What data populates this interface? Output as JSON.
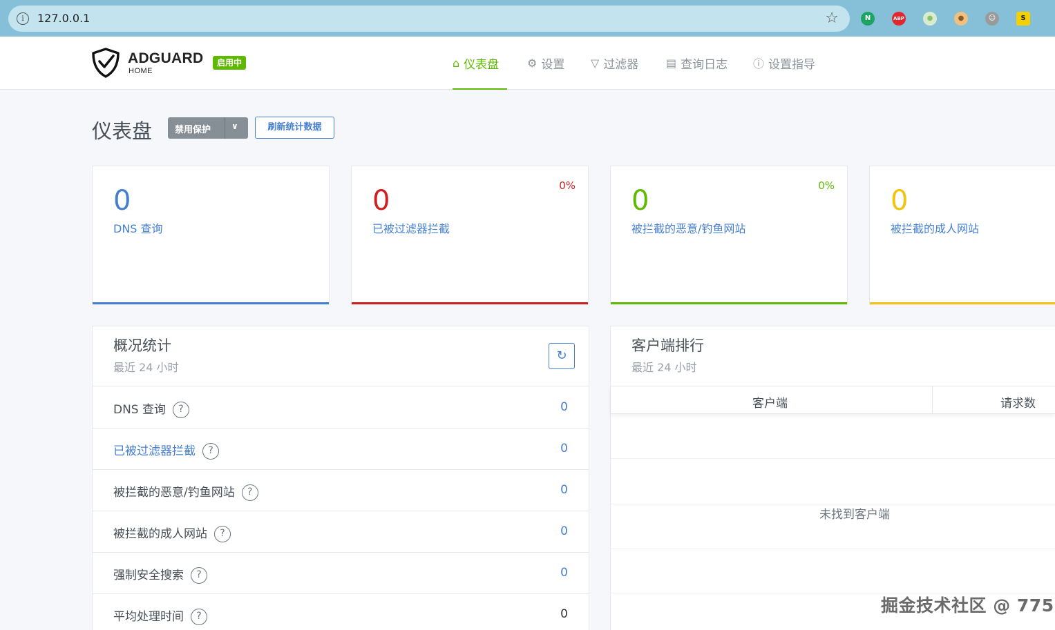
{
  "browser": {
    "url": "127.0.0.1",
    "extensions": [
      {
        "name": "n-icon",
        "glyph": "N",
        "color": "#1da462"
      },
      {
        "name": "adblock-plus-icon",
        "glyph": "ABP",
        "color": "#e3262d"
      },
      {
        "name": "circle-extension-icon",
        "glyph": "●",
        "color": "#8ebf6a"
      },
      {
        "name": "cookie-icon",
        "glyph": "🍪",
        "color": "#c68a3a"
      },
      {
        "name": "monkey-icon",
        "glyph": "🐵",
        "color": "#777777"
      },
      {
        "name": "s-extension-icon",
        "glyph": "S",
        "color": "#f4d000"
      }
    ]
  },
  "header": {
    "brand": "ADGUARD",
    "brand_sub": "HOME",
    "status_badge": "启用中",
    "nav": [
      {
        "label": "仪表盘",
        "icon": "home-icon",
        "active": true
      },
      {
        "label": "设置",
        "icon": "gear-icon",
        "active": false
      },
      {
        "label": "过滤器",
        "icon": "filter-icon",
        "active": false
      },
      {
        "label": "查询日志",
        "icon": "document-icon",
        "active": false
      },
      {
        "label": "设置指导",
        "icon": "help-icon",
        "active": false
      }
    ]
  },
  "page": {
    "title": "仪表盘",
    "disable_protection": "禁用保护",
    "refresh_stats": "刷新统计数据"
  },
  "cards": [
    {
      "value": "0",
      "label": "DNS 查询",
      "percent": "",
      "color": "#467fcf"
    },
    {
      "value": "0",
      "label": "已被过滤器拦截",
      "percent": "0%",
      "color": "#cd201f"
    },
    {
      "value": "0",
      "label": "被拦截的恶意/钓鱼网站",
      "percent": "0%",
      "color": "#5eba00"
    },
    {
      "value": "0",
      "label": "被拦截的成人网站",
      "percent": "",
      "color": "#f1c40f"
    }
  ],
  "overview": {
    "title": "概况统计",
    "subtitle": "最近 24 小时",
    "rows": [
      {
        "label": "DNS 查询",
        "value": "0"
      },
      {
        "label": "已被过滤器拦截",
        "value": "0"
      },
      {
        "label": "被拦截的恶意/钓鱼网站",
        "value": "0"
      },
      {
        "label": "被拦截的成人网站",
        "value": "0"
      },
      {
        "label": "强制安全搜索",
        "value": "0"
      },
      {
        "label": "平均处理时间",
        "value": "0"
      }
    ]
  },
  "clients": {
    "title": "客户端排行",
    "subtitle": "最近 24 小时",
    "col_client": "客户端",
    "col_requests": "请求数",
    "empty": "未找到客户端"
  },
  "watermark": "掘金技术社区 @ 775"
}
